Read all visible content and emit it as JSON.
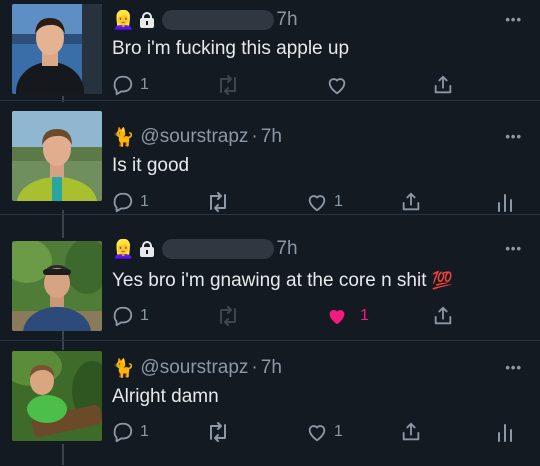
{
  "tweets": [
    {
      "header_emoji": "👱‍♀️",
      "time": "7h",
      "text": "Bro i'm fucking this apple up",
      "reply_count": "1",
      "like_count": "",
      "more": "•••"
    },
    {
      "header_emoji": "🐈",
      "handle": "@sourstrapz",
      "separator": "·",
      "time": "7h",
      "text": "Is it good",
      "reply_count": "1",
      "like_count": "1",
      "more": "•••"
    },
    {
      "header_emoji": "👱‍♀️",
      "time": "7h",
      "text": "Yes bro i'm gnawing at the core n shit",
      "text_emoji": "💯",
      "reply_count": "1",
      "like_count": "1",
      "more": "•••"
    },
    {
      "header_emoji": "🐈",
      "handle": "@sourstrapz",
      "separator": "·",
      "time": "7h",
      "text": "Alright damn",
      "reply_count": "1",
      "like_count": "1",
      "more": "•••"
    }
  ],
  "colors": {
    "background": "#141a22",
    "text": "#e7e9ea",
    "muted": "#8b98a5",
    "like_active": "#f91880"
  }
}
